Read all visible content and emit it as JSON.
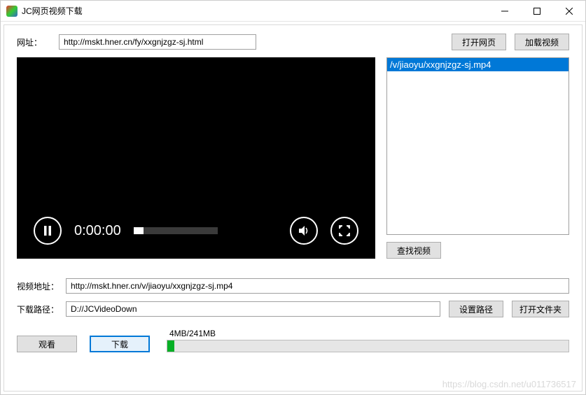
{
  "window": {
    "title": "JC网页视频下载"
  },
  "topRow": {
    "label": "网址：",
    "value": "http://mskt.hner.cn/fy/xxgnjzgz-sj.html",
    "openBtn": "打开网页",
    "loadBtn": "加载视频"
  },
  "player": {
    "time": "0:00:00"
  },
  "list": {
    "items": [
      "/v/jiaoyu/xxgnjzgz-sj.mp4"
    ],
    "selectedIndex": 0,
    "searchBtn": "查找视频"
  },
  "videoAddr": {
    "label": "视频地址：",
    "value": "http://mskt.hner.cn/v/jiaoyu/xxgnjzgz-sj.mp4"
  },
  "downloadPath": {
    "label": "下载路径：",
    "value": "D://JCVideoDown",
    "setBtn": "设置路径",
    "openFolderBtn": "打开文件夹"
  },
  "actions": {
    "watch": "观看",
    "download": "下载"
  },
  "progress": {
    "text": "4MB/241MB",
    "percent": 1.7
  },
  "watermark": "https://blog.csdn.net/u011736517"
}
